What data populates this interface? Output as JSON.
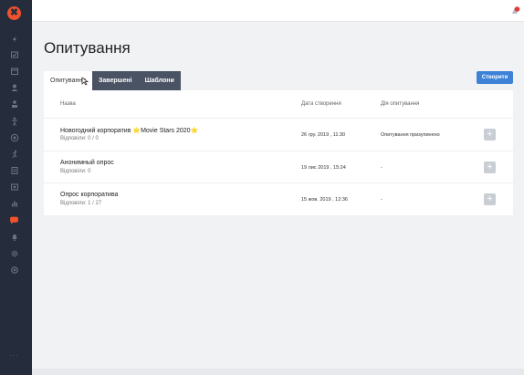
{
  "colors": {
    "sidebar": "#252c3b",
    "accent": "#3d82d6",
    "brand": "#f1522d",
    "tab_dark": "#4a5364"
  },
  "sidebar": {
    "logo": "✖",
    "items": [
      {
        "icon": "lightning-icon"
      },
      {
        "icon": "check-icon"
      },
      {
        "icon": "calendar-icon"
      },
      {
        "icon": "user-icon"
      },
      {
        "icon": "users-icon"
      },
      {
        "icon": "person-icon"
      },
      {
        "icon": "target-icon"
      },
      {
        "icon": "run-icon"
      },
      {
        "icon": "doc-icon"
      },
      {
        "icon": "gallery-icon"
      },
      {
        "icon": "chart-icon"
      },
      {
        "icon": "chat-icon",
        "active": true
      },
      {
        "icon": "bell-icon"
      },
      {
        "icon": "gear-icon"
      },
      {
        "icon": "settings-icon"
      }
    ],
    "more": "···"
  },
  "header": {
    "caret": "▾"
  },
  "page": {
    "title": "Опитування"
  },
  "tabs": [
    {
      "label": "Опитування",
      "active": true
    },
    {
      "label": "Завершені",
      "active": false
    },
    {
      "label": "Шаблони",
      "active": false
    }
  ],
  "create_button": "Створити",
  "table": {
    "columns": [
      "Назва",
      "Дата створення",
      "Дія опитування"
    ],
    "rows": [
      {
        "name": "Новогодний корпоратив ⭐Movie Stars 2020⭐",
        "responses": "Відповіли: 0 / 0",
        "date": "26 гру. 2019 , 11:30",
        "action": "Опитування призупинено",
        "add": "+"
      },
      {
        "name": "Анонимный опрос",
        "responses": "Відповіли: 0",
        "date": "19 лис 2019 , 15:24",
        "action": "-",
        "add": "+"
      },
      {
        "name": "Опрос корпоратива",
        "responses": "Відповіли: 1 / 27",
        "date": "15 жов. 2019 , 12:36",
        "action": "-",
        "add": "+"
      }
    ]
  }
}
